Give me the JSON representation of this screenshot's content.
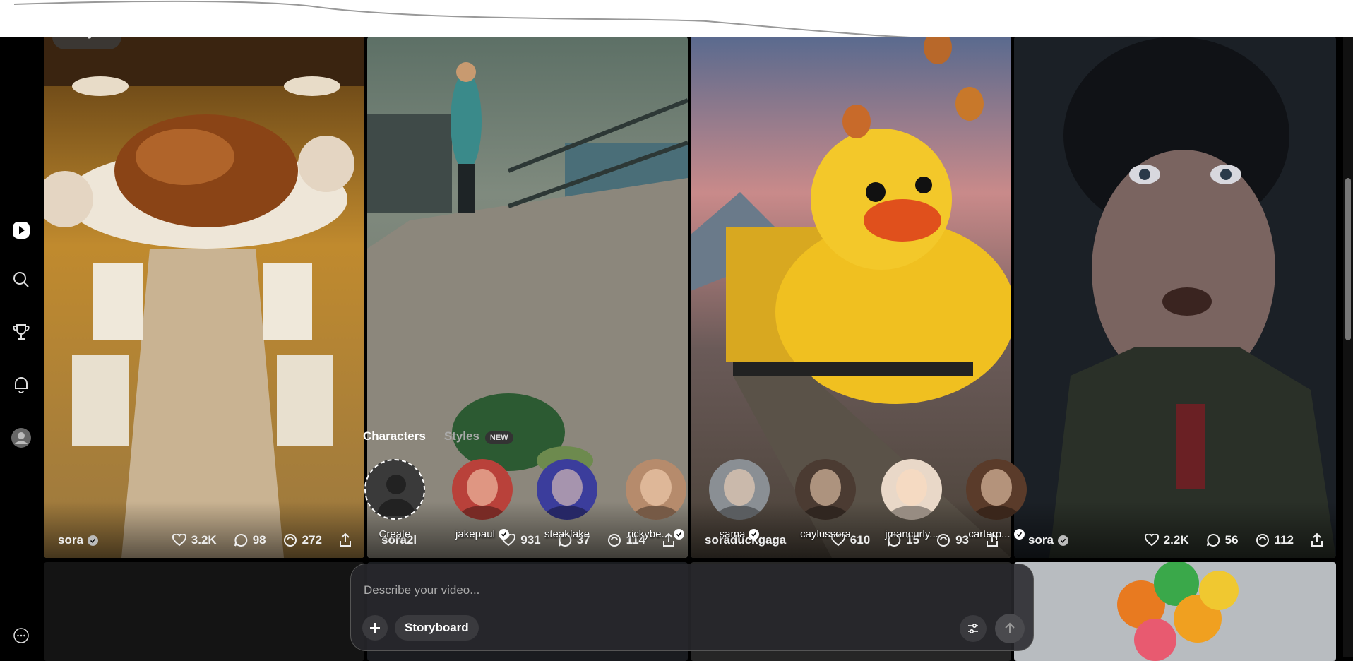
{
  "sidebar": {
    "items": [
      {
        "icon": "play-icon",
        "active": true
      },
      {
        "icon": "search-icon"
      },
      {
        "icon": "trophy-icon"
      },
      {
        "icon": "bell-icon"
      },
      {
        "icon": "profile-icon"
      },
      {
        "icon": "more-icon"
      }
    ]
  },
  "feed_tab": {
    "label": "For you"
  },
  "cards": [
    {
      "author": "sora",
      "likes": "3.2K",
      "comments": "98",
      "remixes": "272"
    },
    {
      "author": "sora2l",
      "likes": "931",
      "comments": "37",
      "remixes": "114"
    },
    {
      "author": "soraduckgaga",
      "likes": "610",
      "comments": "15",
      "remixes": "93"
    },
    {
      "author": "sora",
      "likes": "2.2K",
      "comments": "56",
      "remixes": "112"
    }
  ],
  "characters_panel": {
    "tab_characters": "Characters",
    "tab_styles": "Styles",
    "styles_badge": "NEW",
    "create_label": "Create",
    "characters": [
      {
        "name": "jakepaul",
        "verified": true,
        "color": "#b9413a"
      },
      {
        "name": "steakfake",
        "verified": false,
        "color": "#3b3d9c"
      },
      {
        "name": "rickybe...",
        "verified": true,
        "color": "#b68b6c"
      },
      {
        "name": "sama",
        "verified": true,
        "color": "#8a8f94"
      },
      {
        "name": "caylussora",
        "verified": false,
        "color": "#4b3b32"
      },
      {
        "name": "jmancurly...",
        "verified": false,
        "color": "#e9d8c8"
      },
      {
        "name": "carterp...",
        "verified": true,
        "color": "#5a3b2a"
      }
    ]
  },
  "prompt": {
    "placeholder": "Describe your video...",
    "storyboard_label": "Storyboard"
  },
  "colors": {
    "background": "#000000",
    "panel": "#28282c",
    "accent": "#ffffff"
  }
}
